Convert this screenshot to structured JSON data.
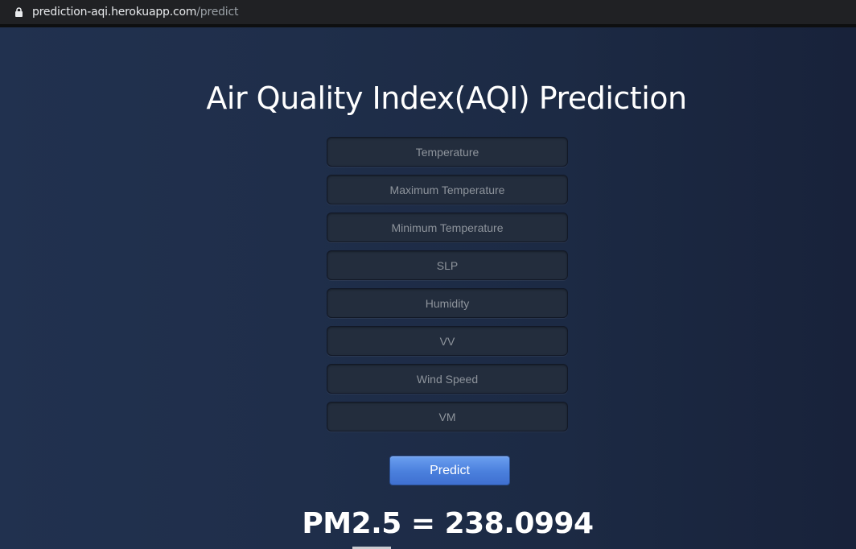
{
  "browser": {
    "url_host": "prediction-aqi.herokuapp.com",
    "url_path": "/predict",
    "lock_icon": "lock-icon"
  },
  "page": {
    "title": "Air Quality Index(AQI) Prediction",
    "fields": [
      {
        "placeholder": "Temperature",
        "value": ""
      },
      {
        "placeholder": "Maximum Temperature",
        "value": ""
      },
      {
        "placeholder": "Minimum Temperature",
        "value": ""
      },
      {
        "placeholder": "SLP",
        "value": ""
      },
      {
        "placeholder": "Humidity",
        "value": ""
      },
      {
        "placeholder": "VV",
        "value": ""
      },
      {
        "placeholder": "Wind Speed",
        "value": ""
      },
      {
        "placeholder": "VM",
        "value": ""
      }
    ],
    "predict_label": "Predict",
    "result_text": "PM2.5 = 238.0994"
  },
  "colors": {
    "background_start": "#21314f",
    "background_end": "#18223a",
    "button": "#4a7fdc",
    "field_background": "#232d3d"
  }
}
